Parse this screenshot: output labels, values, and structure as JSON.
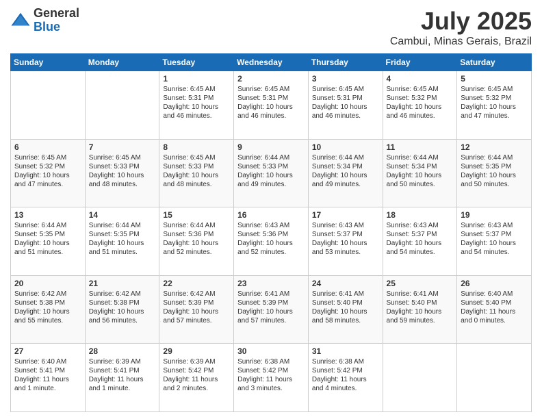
{
  "header": {
    "logo_general": "General",
    "logo_blue": "Blue",
    "title": "July 2025",
    "location": "Cambui, Minas Gerais, Brazil"
  },
  "weekdays": [
    "Sunday",
    "Monday",
    "Tuesday",
    "Wednesday",
    "Thursday",
    "Friday",
    "Saturday"
  ],
  "weeks": [
    [
      {
        "day": "",
        "info": ""
      },
      {
        "day": "",
        "info": ""
      },
      {
        "day": "1",
        "info": "Sunrise: 6:45 AM\nSunset: 5:31 PM\nDaylight: 10 hours and 46 minutes."
      },
      {
        "day": "2",
        "info": "Sunrise: 6:45 AM\nSunset: 5:31 PM\nDaylight: 10 hours and 46 minutes."
      },
      {
        "day": "3",
        "info": "Sunrise: 6:45 AM\nSunset: 5:31 PM\nDaylight: 10 hours and 46 minutes."
      },
      {
        "day": "4",
        "info": "Sunrise: 6:45 AM\nSunset: 5:32 PM\nDaylight: 10 hours and 46 minutes."
      },
      {
        "day": "5",
        "info": "Sunrise: 6:45 AM\nSunset: 5:32 PM\nDaylight: 10 hours and 47 minutes."
      }
    ],
    [
      {
        "day": "6",
        "info": "Sunrise: 6:45 AM\nSunset: 5:32 PM\nDaylight: 10 hours and 47 minutes."
      },
      {
        "day": "7",
        "info": "Sunrise: 6:45 AM\nSunset: 5:33 PM\nDaylight: 10 hours and 48 minutes."
      },
      {
        "day": "8",
        "info": "Sunrise: 6:45 AM\nSunset: 5:33 PM\nDaylight: 10 hours and 48 minutes."
      },
      {
        "day": "9",
        "info": "Sunrise: 6:44 AM\nSunset: 5:33 PM\nDaylight: 10 hours and 49 minutes."
      },
      {
        "day": "10",
        "info": "Sunrise: 6:44 AM\nSunset: 5:34 PM\nDaylight: 10 hours and 49 minutes."
      },
      {
        "day": "11",
        "info": "Sunrise: 6:44 AM\nSunset: 5:34 PM\nDaylight: 10 hours and 50 minutes."
      },
      {
        "day": "12",
        "info": "Sunrise: 6:44 AM\nSunset: 5:35 PM\nDaylight: 10 hours and 50 minutes."
      }
    ],
    [
      {
        "day": "13",
        "info": "Sunrise: 6:44 AM\nSunset: 5:35 PM\nDaylight: 10 hours and 51 minutes."
      },
      {
        "day": "14",
        "info": "Sunrise: 6:44 AM\nSunset: 5:35 PM\nDaylight: 10 hours and 51 minutes."
      },
      {
        "day": "15",
        "info": "Sunrise: 6:44 AM\nSunset: 5:36 PM\nDaylight: 10 hours and 52 minutes."
      },
      {
        "day": "16",
        "info": "Sunrise: 6:43 AM\nSunset: 5:36 PM\nDaylight: 10 hours and 52 minutes."
      },
      {
        "day": "17",
        "info": "Sunrise: 6:43 AM\nSunset: 5:37 PM\nDaylight: 10 hours and 53 minutes."
      },
      {
        "day": "18",
        "info": "Sunrise: 6:43 AM\nSunset: 5:37 PM\nDaylight: 10 hours and 54 minutes."
      },
      {
        "day": "19",
        "info": "Sunrise: 6:43 AM\nSunset: 5:37 PM\nDaylight: 10 hours and 54 minutes."
      }
    ],
    [
      {
        "day": "20",
        "info": "Sunrise: 6:42 AM\nSunset: 5:38 PM\nDaylight: 10 hours and 55 minutes."
      },
      {
        "day": "21",
        "info": "Sunrise: 6:42 AM\nSunset: 5:38 PM\nDaylight: 10 hours and 56 minutes."
      },
      {
        "day": "22",
        "info": "Sunrise: 6:42 AM\nSunset: 5:39 PM\nDaylight: 10 hours and 57 minutes."
      },
      {
        "day": "23",
        "info": "Sunrise: 6:41 AM\nSunset: 5:39 PM\nDaylight: 10 hours and 57 minutes."
      },
      {
        "day": "24",
        "info": "Sunrise: 6:41 AM\nSunset: 5:40 PM\nDaylight: 10 hours and 58 minutes."
      },
      {
        "day": "25",
        "info": "Sunrise: 6:41 AM\nSunset: 5:40 PM\nDaylight: 10 hours and 59 minutes."
      },
      {
        "day": "26",
        "info": "Sunrise: 6:40 AM\nSunset: 5:40 PM\nDaylight: 11 hours and 0 minutes."
      }
    ],
    [
      {
        "day": "27",
        "info": "Sunrise: 6:40 AM\nSunset: 5:41 PM\nDaylight: 11 hours and 1 minute."
      },
      {
        "day": "28",
        "info": "Sunrise: 6:39 AM\nSunset: 5:41 PM\nDaylight: 11 hours and 1 minute."
      },
      {
        "day": "29",
        "info": "Sunrise: 6:39 AM\nSunset: 5:42 PM\nDaylight: 11 hours and 2 minutes."
      },
      {
        "day": "30",
        "info": "Sunrise: 6:38 AM\nSunset: 5:42 PM\nDaylight: 11 hours and 3 minutes."
      },
      {
        "day": "31",
        "info": "Sunrise: 6:38 AM\nSunset: 5:42 PM\nDaylight: 11 hours and 4 minutes."
      },
      {
        "day": "",
        "info": ""
      },
      {
        "day": "",
        "info": ""
      }
    ]
  ]
}
